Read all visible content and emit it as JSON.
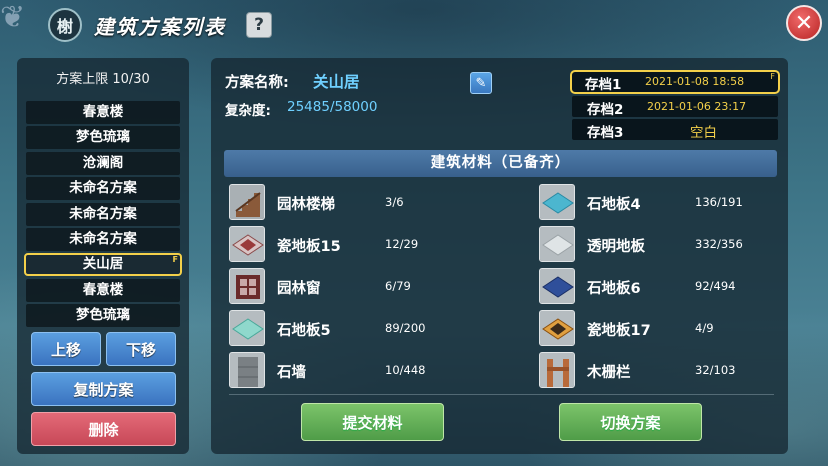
{
  "header": {
    "logo_glyph": "榭",
    "title": "建筑方案列表",
    "help_label": "?",
    "close_label": "✕"
  },
  "left": {
    "quota_text": "方案上限 10/30",
    "plans": [
      {
        "label": "春意楼",
        "selected": false
      },
      {
        "label": "梦色琉璃",
        "selected": false
      },
      {
        "label": "沧澜阁",
        "selected": false
      },
      {
        "label": "未命名方案",
        "selected": false
      },
      {
        "label": "未命名方案",
        "selected": false
      },
      {
        "label": "未命名方案",
        "selected": false
      },
      {
        "label": "关山居",
        "selected": true
      },
      {
        "label": "春意楼",
        "selected": false
      },
      {
        "label": "梦色琉璃",
        "selected": false
      }
    ],
    "selected_tag": "F",
    "move_up_label": "上移",
    "move_down_label": "下移",
    "copy_label": "复制方案",
    "delete_label": "删除"
  },
  "detail": {
    "name_label": "方案名称:",
    "name_value": "关山居",
    "complexity_label": "复杂度:",
    "complexity_value": "25485/58000",
    "edit_icon": "✎"
  },
  "saves": [
    {
      "name": "存档1",
      "date": "2021-01-08 18:58",
      "selected": true,
      "tag": "F"
    },
    {
      "name": "存档2",
      "date": "2021-01-06 23:17",
      "selected": false
    },
    {
      "name": "存档3",
      "empty_text": "空白",
      "selected": false
    }
  ],
  "materials": {
    "header": "建筑材料（已备齐）",
    "rows": [
      [
        {
          "name": "园林楼梯",
          "count": "3/6",
          "icon": "stairs-icon"
        },
        {
          "name": "石地板4",
          "count": "136/191",
          "icon": "cyan-floor-tile-icon"
        }
      ],
      [
        {
          "name": "瓷地板15",
          "count": "12/29",
          "icon": "patterned-tile-icon"
        },
        {
          "name": "透明地板",
          "count": "332/356",
          "icon": "transparent-floor-icon"
        }
      ],
      [
        {
          "name": "园林窗",
          "count": "6/79",
          "icon": "garden-window-icon"
        },
        {
          "name": "石地板6",
          "count": "92/494",
          "icon": "blue-floor-tile-icon"
        }
      ],
      [
        {
          "name": "石地板5",
          "count": "89/200",
          "icon": "mint-floor-tile-icon"
        },
        {
          "name": "瓷地板17",
          "count": "4/9",
          "icon": "orange-patterned-tile-icon"
        }
      ],
      [
        {
          "name": "石墙",
          "count": "10/448",
          "icon": "stone-wall-icon"
        },
        {
          "name": "木栅栏",
          "count": "32/103",
          "icon": "wooden-fence-icon"
        }
      ]
    ]
  },
  "actions": {
    "submit_label": "提交材料",
    "switch_label": "切换方案"
  },
  "colors": {
    "highlight": "#f3d04a",
    "accent_text": "#6fd0ff"
  }
}
